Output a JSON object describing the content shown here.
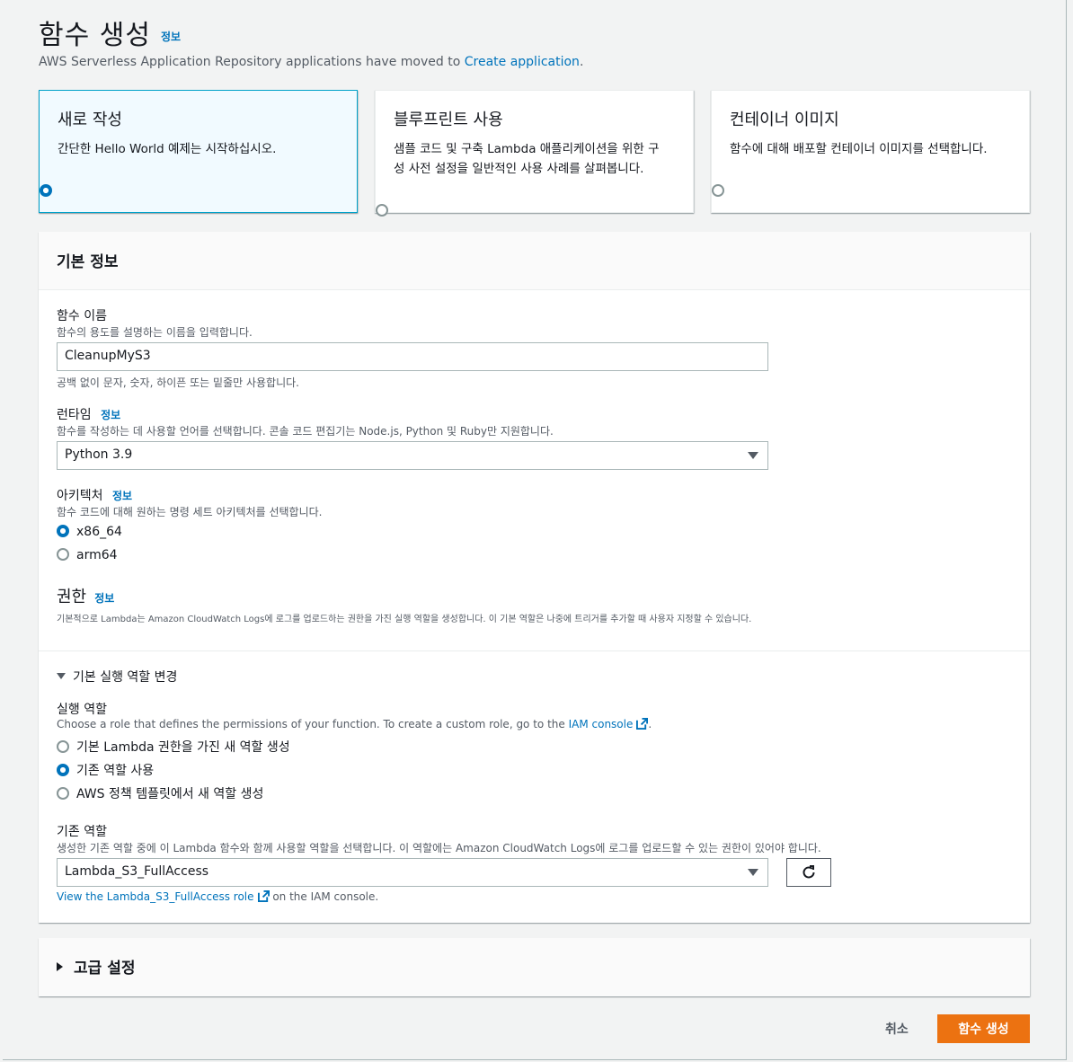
{
  "header": {
    "title": "함수 생성",
    "info": "정보",
    "notice_text": "AWS Serverless Application Repository applications have moved to ",
    "notice_link": "Create application",
    "notice_end": "."
  },
  "tiles": [
    {
      "title": "새로 작성",
      "desc": "간단한 Hello World 예제는 시작하십시오.",
      "selected": true
    },
    {
      "title": "블루프린트 사용",
      "desc": "샘플 코드 및 구축 Lambda 애플리케이션을 위한 구성 사전 설정을 일반적인 사용 사례를 살펴봅니다.",
      "selected": false
    },
    {
      "title": "컨테이너 이미지",
      "desc": "함수에 대해 배포할 컨테이너 이미지를 선택합니다.",
      "selected": false
    }
  ],
  "basic": {
    "header": "기본 정보",
    "fn_name_label": "함수 이름",
    "fn_name_desc": "함수의 용도를 설명하는 이름을 입력합니다.",
    "fn_name_value": "CleanupMyS3",
    "fn_name_hint": "공백 없이 문자, 숫자, 하이픈 또는 밑줄만 사용합니다.",
    "runtime_label": "런타임",
    "runtime_info": "정보",
    "runtime_desc": "함수를 작성하는 데 사용할 언어를 선택합니다. 콘솔 코드 편집기는 Node.js, Python 및 Ruby만 지원합니다.",
    "runtime_value": "Python 3.9",
    "arch_label": "아키텍처",
    "arch_info": "정보",
    "arch_desc": "함수 코드에 대해 원하는 명령 세트 아키텍처를 선택합니다.",
    "arch_options": [
      "x86_64",
      "arm64"
    ],
    "arch_selected": "x86_64",
    "perm_label": "권한",
    "perm_info": "정보",
    "perm_desc": "기본적으로 Lambda는 Amazon CloudWatch Logs에 로그를 업로드하는 권한을 가진 실행 역할을 생성합니다. 이 기본 역할은 나중에 트리거를 추가할 때 사용자 지정할 수 있습니다.",
    "exec_toggle": "기본 실행 역할 변경",
    "exec_label": "실행 역할",
    "exec_desc": "Choose a role that defines the permissions of your function. To create a custom role, go to the ",
    "exec_desc_link": "IAM console",
    "exec_desc_end": ".",
    "exec_options": [
      "기본 Lambda 권한을 가진 새 역할 생성",
      "기존 역할 사용",
      "AWS 정책 템플릿에서 새 역할 생성"
    ],
    "exec_selected": "기존 역할 사용",
    "existing_label": "기존 역할",
    "existing_desc": "생성한 기존 역할 중에 이 Lambda 함수와 함께 사용할 역할을 선택합니다. 이 역할에는 Amazon CloudWatch Logs에 로그를 업로드할 수 있는 권한이 있어야 합니다.",
    "existing_value": "Lambda_S3_FullAccess",
    "view_role_link": "View the Lambda_S3_FullAccess role",
    "view_role_end": "on the IAM console."
  },
  "advanced": {
    "header": "고급 설정"
  },
  "footer": {
    "cancel": "취소",
    "create": "함수 생성"
  },
  "colors": {
    "primary": "#ec7211",
    "link": "#0073bb",
    "selected_border": "#00a1c9"
  }
}
